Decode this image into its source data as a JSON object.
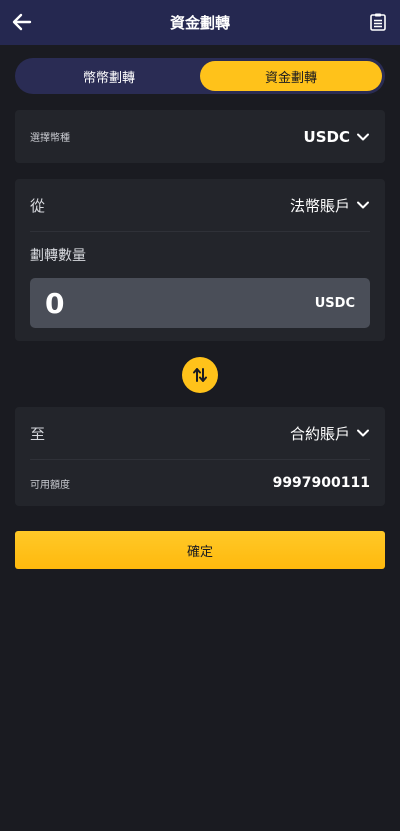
{
  "header": {
    "title": "資金劃轉",
    "back_icon": "arrow-left-icon",
    "record_icon": "clipboard-icon"
  },
  "tabs": [
    {
      "label": "幣幣劃轉",
      "active": false
    },
    {
      "label": "資金劃轉",
      "active": true
    }
  ],
  "coin": {
    "label": "選擇幣種",
    "value": "USDC"
  },
  "from": {
    "label": "從",
    "account": "法幣賬戶"
  },
  "amount": {
    "label": "劃轉數量",
    "value": "0",
    "unit": "USDC"
  },
  "to": {
    "label": "至",
    "account": "合約賬戶",
    "available_label": "可用額度",
    "available_value": "9997900111"
  },
  "confirm_label": "確定",
  "colors": {
    "accent": "#ffc21a",
    "header_bg": "#252850",
    "page_bg": "#1a1b21",
    "card_bg": "#23252b"
  }
}
